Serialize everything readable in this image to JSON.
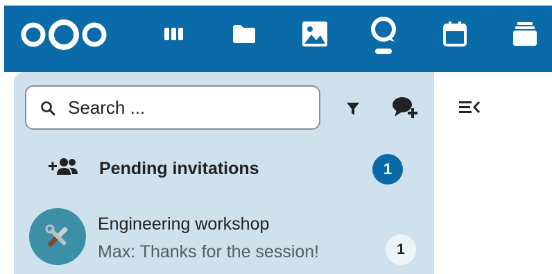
{
  "header": {
    "logo_icon": "nextcloud-logo",
    "apps": [
      {
        "icon": "dashboard-icon"
      },
      {
        "icon": "files-folder-icon"
      },
      {
        "icon": "photos-icon"
      },
      {
        "icon": "talk-icon"
      },
      {
        "icon": "calendar-icon"
      },
      {
        "icon": "deck-stack-icon"
      }
    ]
  },
  "search": {
    "placeholder": "Search ..."
  },
  "toolbar": {
    "filter_icon": "filter-icon",
    "new_conversation_icon": "new-conversation-icon"
  },
  "pending": {
    "label": "Pending invitations",
    "count": "1"
  },
  "conversations": [
    {
      "name": "Engineering workshop",
      "last_message": "Max: Thanks for the session!",
      "unread": "1",
      "avatar_icon": "tools-icon"
    }
  ],
  "main": {
    "toggle_icon": "sidebar-toggle-icon"
  },
  "colors": {
    "header": "#0b6aa8",
    "sidebar": "#cfe1ed",
    "badge": "#0b6aa8",
    "avatar": "#3b8fa6"
  }
}
